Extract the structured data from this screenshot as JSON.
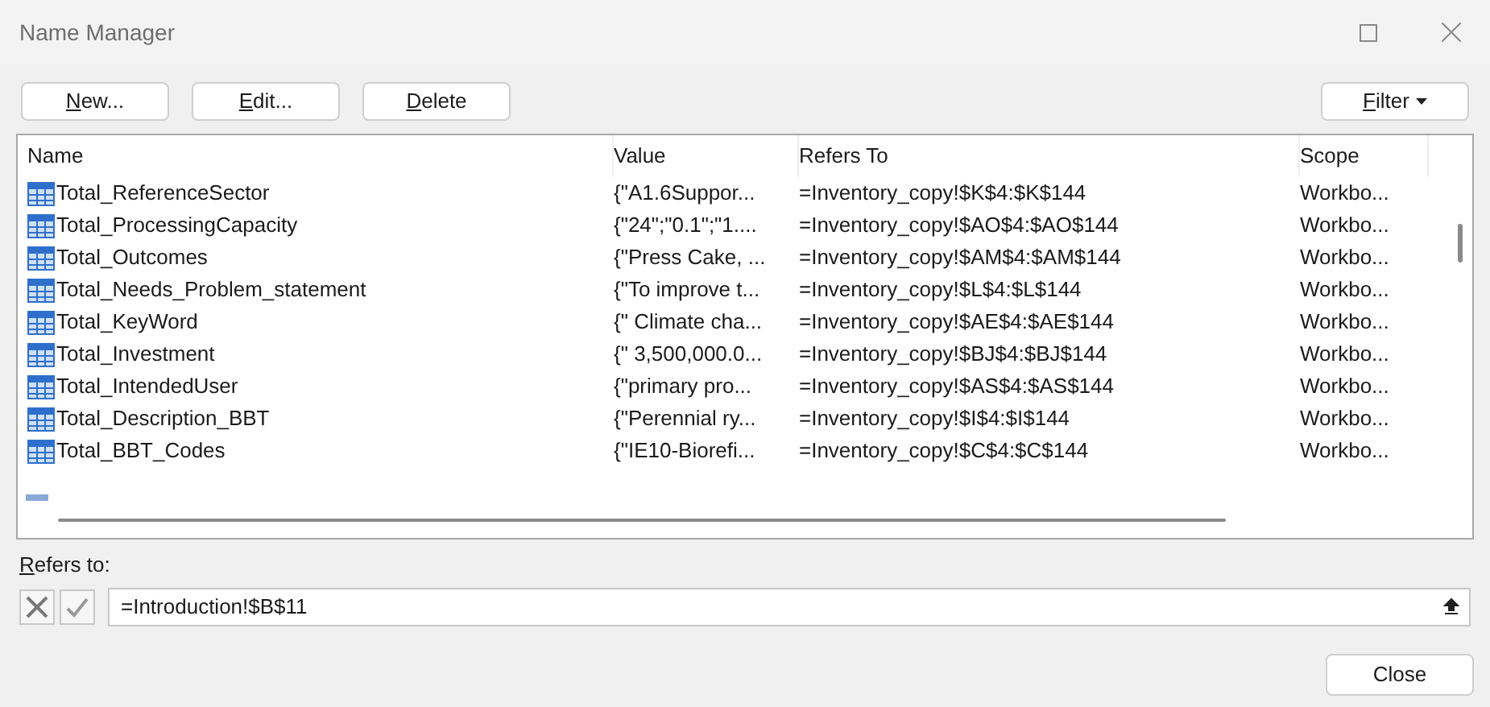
{
  "window": {
    "title": "Name Manager"
  },
  "toolbar": [
    {
      "label": "New...",
      "mnemonic": true
    },
    {
      "label": "Edit...",
      "mnemonic": true
    },
    {
      "label": "Delete",
      "mnemonic": true
    }
  ],
  "filter_button": {
    "label": "Filter",
    "mnemonic": true
  },
  "table": {
    "columns": [
      "Name",
      "Value",
      "Refers To",
      "Scope"
    ],
    "rows": [
      {
        "name": "Total_ReferenceSector",
        "value": "{\"A1.6Suppor...",
        "refers_to": "=Inventory_copy!$K$4:$K$144",
        "scope": "Workbo..."
      },
      {
        "name": "Total_ProcessingCapacity",
        "value": "{\"24\";\"0.1\";\"1....",
        "refers_to": "=Inventory_copy!$AO$4:$AO$144",
        "scope": "Workbo..."
      },
      {
        "name": "Total_Outcomes",
        "value": "{\"Press Cake, ...",
        "refers_to": "=Inventory_copy!$AM$4:$AM$144",
        "scope": "Workbo..."
      },
      {
        "name": "Total_Needs_Problem_statement",
        "value": "{\"To improve t...",
        "refers_to": "=Inventory_copy!$L$4:$L$144",
        "scope": "Workbo..."
      },
      {
        "name": "Total_KeyWord",
        "value": "{\" Climate cha...",
        "refers_to": "=Inventory_copy!$AE$4:$AE$144",
        "scope": "Workbo..."
      },
      {
        "name": "Total_Investment",
        "value": "{\" 3,500,000.0...",
        "refers_to": "=Inventory_copy!$BJ$4:$BJ$144",
        "scope": "Workbo..."
      },
      {
        "name": "Total_IntendedUser",
        "value": "{\"primary pro...",
        "refers_to": "=Inventory_copy!$AS$4:$AS$144",
        "scope": "Workbo..."
      },
      {
        "name": "Total_Description_BBT",
        "value": "{\"Perennial ry...",
        "refers_to": "=Inventory_copy!$I$4:$I$144",
        "scope": "Workbo..."
      },
      {
        "name": "Total_BBT_Codes",
        "value": "{\"IE10-Biorefi...",
        "refers_to": "=Inventory_copy!$C$4:$C$144",
        "scope": "Workbo..."
      }
    ]
  },
  "refers_to": {
    "label": "Refers to:",
    "mnemonic": true,
    "value": "=Introduction!$B$11"
  },
  "close_button": {
    "label": "Close"
  }
}
